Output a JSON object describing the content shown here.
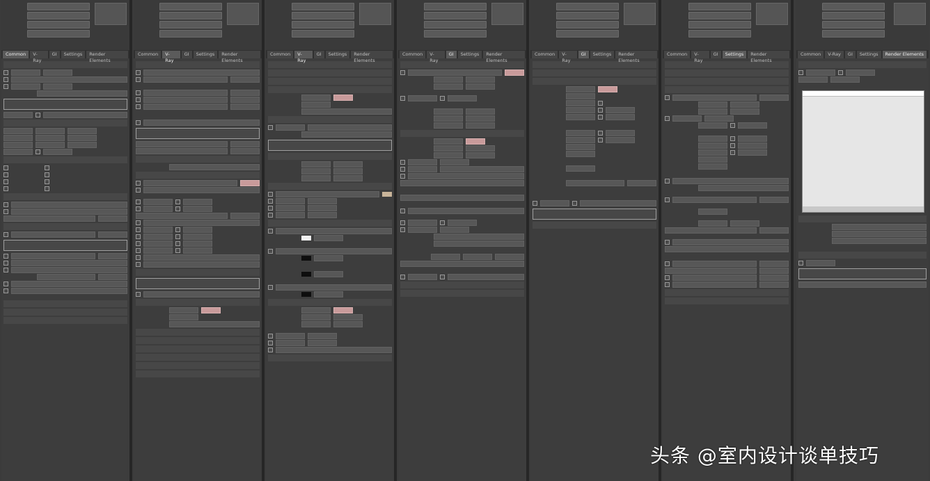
{
  "watermark": "头条 @室内设计谈单技巧",
  "tabs": [
    "Common",
    "V-Ray",
    "GI",
    "Settings",
    "Render Elements"
  ],
  "colors": {
    "background": "#3b3b3b",
    "panel": "#3d3d3d",
    "section": "#474747",
    "swatch_pink": "#c99b9b",
    "swatch_white": "#f2f2f2",
    "swatch_black": "#0e0e0e"
  }
}
